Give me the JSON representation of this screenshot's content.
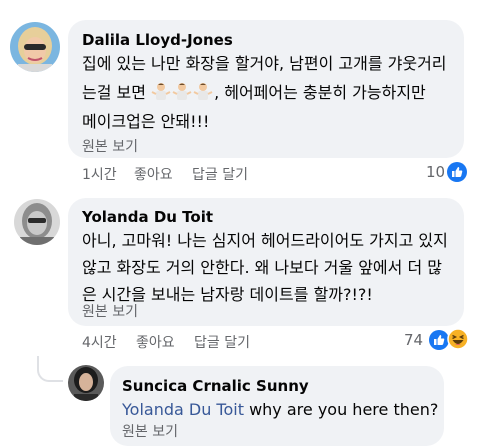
{
  "comments": [
    {
      "author": "Dalila Lloyd-Jones",
      "text_line1": "집에 있는 나만 화장을 할거야, 남편이 고개를 갸웃거리",
      "text_line2_before": "는걸 보면",
      "text_line2_after": ", 헤어페어는 충분히 가능하지만",
      "text_line3": "메이크업은 안돼!!!",
      "emoji_icon": "person-shrugging-icon",
      "see_original": "원본 보기",
      "time": "1시간",
      "like_label": "좋아요",
      "reply_label": "답글 달기",
      "reaction_count": "10",
      "reaction_icons": [
        "like-reaction-icon"
      ]
    },
    {
      "author": "Yolanda Du Toit",
      "text_line1": "아니, 고마워! 나는 심지어 헤어드라이어도 가지고 있지",
      "text_line2": "않고 화장도 거의 안한다. 왜 나보다 거울 앞에서 더 많",
      "text_line3": "은 시간을 보내는 남자랑 데이트를 할까?!?!",
      "see_original": "원본 보기",
      "time": "4시간",
      "like_label": "좋아요",
      "reply_label": "답글 달기",
      "reaction_count": "74",
      "reaction_icons": [
        "like-reaction-icon",
        "haha-reaction-icon"
      ]
    }
  ],
  "reply": {
    "author": "Suncica Crnalic Sunny",
    "mention": "Yolanda Du Toit",
    "text": "why are you here then?",
    "see_original": "원본 보기"
  },
  "colors": {
    "bubble": "#f0f2f5",
    "meta": "#65676b",
    "mention": "#385898",
    "like_blue": "#1877f2",
    "haha_yellow": "#f7b125"
  }
}
